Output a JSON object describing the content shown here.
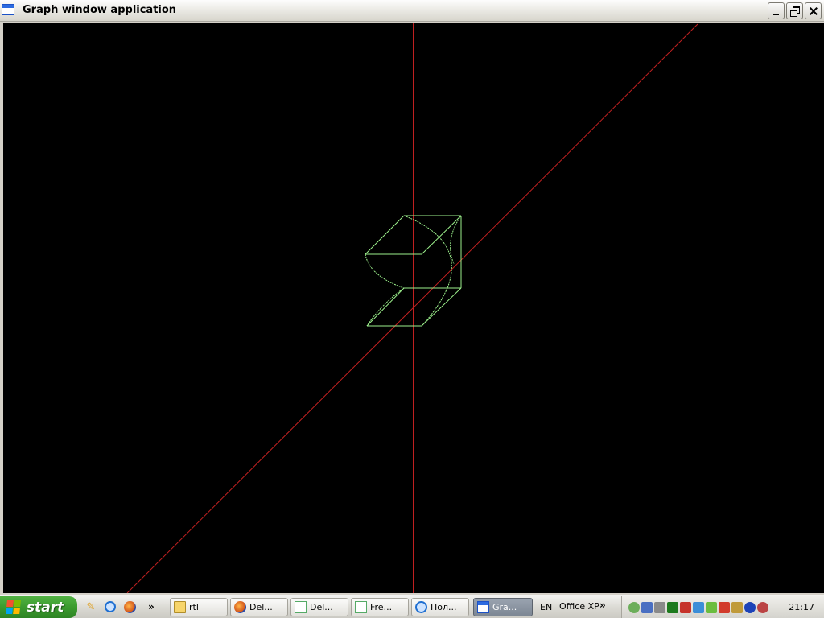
{
  "window": {
    "title": "Graph window application",
    "controls": [
      "minimize",
      "restore",
      "close"
    ]
  },
  "canvas": {
    "background": "#000000",
    "axis_color": "#c02020",
    "shape_color": "#9cf08c"
  },
  "taskbar": {
    "start_label": "start",
    "quick_launch": [
      "pencil-icon",
      "internet-explorer-icon",
      "firefox-icon"
    ],
    "quick_launch_more": "»",
    "tasks": [
      {
        "icon": "folder-icon",
        "label": "rtl",
        "active": false
      },
      {
        "icon": "firefox-icon",
        "label": "Del...",
        "active": false
      },
      {
        "icon": "document-icon",
        "label": "Del...",
        "active": false
      },
      {
        "icon": "document-icon",
        "label": "Fre...",
        "active": false
      },
      {
        "icon": "internet-explorer-icon",
        "label": "Пол...",
        "active": false
      },
      {
        "icon": "window-icon",
        "label": "Gra...",
        "active": true
      }
    ],
    "language": "EN",
    "toolbar_label": "Office XP",
    "toolbar_more": "»",
    "tray_icons": [
      "network-icon",
      "display-icon",
      "printer-icon",
      "green-square-icon",
      "red-pen-icon",
      "blue-network-icon",
      "green-arrow-icon",
      "red-arrow-icon",
      "tool-icon",
      "blue-circle-icon",
      "red-gear-icon"
    ],
    "clock": "21:17"
  }
}
